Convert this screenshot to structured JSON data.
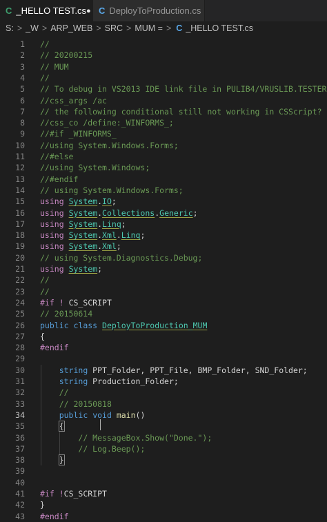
{
  "tabs": [
    {
      "label": "_HELLO TEST.cs",
      "icon": "csharp-icon",
      "active": true,
      "modified_dot": "●"
    },
    {
      "label": "DeployToProduction.cs",
      "icon": "csharp-icon",
      "active": false
    }
  ],
  "breadcrumb": {
    "parts": [
      "S:",
      "_W",
      "ARP_WEB",
      "SRC",
      "MUM ="
    ],
    "file": "_HELLO TEST.cs",
    "separator": ">"
  },
  "editor": {
    "current_line": 34,
    "lines": [
      {
        "n": "1",
        "tokens": [
          {
            "t": "//",
            "c": "comment"
          }
        ]
      },
      {
        "n": "2",
        "tokens": [
          {
            "t": "// 20200215",
            "c": "comment"
          }
        ]
      },
      {
        "n": "3",
        "tokens": [
          {
            "t": "// MUM",
            "c": "comment"
          }
        ]
      },
      {
        "n": "4",
        "tokens": [
          {
            "t": "//",
            "c": "comment"
          }
        ]
      },
      {
        "n": "5",
        "tokens": [
          {
            "t": "// To debug in VS2013 IDE link file in PULIB4/VRUSLIB.TESTER",
            "c": "comment"
          }
        ]
      },
      {
        "n": "6",
        "tokens": [
          {
            "t": "//css_args /ac",
            "c": "comment"
          }
        ]
      },
      {
        "n": "7",
        "tokens": [
          {
            "t": "// the following conditional still not working in CSScript?",
            "c": "comment"
          }
        ]
      },
      {
        "n": "8",
        "tokens": [
          {
            "t": "//css_co /define:_WINFORMS_;",
            "c": "comment"
          }
        ]
      },
      {
        "n": "9",
        "tokens": [
          {
            "t": "//#if _WINFORMS_",
            "c": "comment"
          }
        ]
      },
      {
        "n": "10",
        "tokens": [
          {
            "t": "//using System.Windows.Forms;",
            "c": "comment"
          }
        ]
      },
      {
        "n": "11",
        "tokens": [
          {
            "t": "//#else",
            "c": "comment"
          }
        ]
      },
      {
        "n": "12",
        "tokens": [
          {
            "t": "//using System.Windows;",
            "c": "comment"
          }
        ]
      },
      {
        "n": "13",
        "tokens": [
          {
            "t": "//#endif",
            "c": "comment"
          }
        ]
      },
      {
        "n": "14",
        "tokens": [
          {
            "t": "// using System.Windows.Forms;",
            "c": "comment"
          }
        ]
      },
      {
        "n": "15",
        "tokens": [
          {
            "t": "using",
            "c": "using"
          },
          {
            "t": " ",
            "c": "ident"
          },
          {
            "t": "System",
            "c": "ns"
          },
          {
            "t": ".",
            "c": "ident"
          },
          {
            "t": "IO",
            "c": "ns"
          },
          {
            "t": ";",
            "c": "ident"
          }
        ]
      },
      {
        "n": "16",
        "tokens": [
          {
            "t": "using",
            "c": "using"
          },
          {
            "t": " ",
            "c": "ident"
          },
          {
            "t": "System",
            "c": "ns"
          },
          {
            "t": ".",
            "c": "ident"
          },
          {
            "t": "Collections",
            "c": "ns"
          },
          {
            "t": ".",
            "c": "ident"
          },
          {
            "t": "Generic",
            "c": "ns"
          },
          {
            "t": ";",
            "c": "ident"
          }
        ]
      },
      {
        "n": "17",
        "tokens": [
          {
            "t": "using",
            "c": "using"
          },
          {
            "t": " ",
            "c": "ident"
          },
          {
            "t": "System",
            "c": "ns"
          },
          {
            "t": ".",
            "c": "ident"
          },
          {
            "t": "Linq",
            "c": "ns"
          },
          {
            "t": ";",
            "c": "ident"
          }
        ]
      },
      {
        "n": "18",
        "tokens": [
          {
            "t": "using",
            "c": "using"
          },
          {
            "t": " ",
            "c": "ident"
          },
          {
            "t": "System",
            "c": "ns"
          },
          {
            "t": ".",
            "c": "ident"
          },
          {
            "t": "Xml",
            "c": "ns"
          },
          {
            "t": ".",
            "c": "ident"
          },
          {
            "t": "Linq",
            "c": "ns"
          },
          {
            "t": ";",
            "c": "ident"
          }
        ]
      },
      {
        "n": "19",
        "tokens": [
          {
            "t": "using",
            "c": "using"
          },
          {
            "t": " ",
            "c": "ident"
          },
          {
            "t": "System",
            "c": "ns"
          },
          {
            "t": ".",
            "c": "ident"
          },
          {
            "t": "Xml",
            "c": "ns"
          },
          {
            "t": ";",
            "c": "ident"
          }
        ]
      },
      {
        "n": "20",
        "tokens": [
          {
            "t": "// using System.Diagnostics.Debug;",
            "c": "comment"
          }
        ]
      },
      {
        "n": "21",
        "tokens": [
          {
            "t": "using",
            "c": "using"
          },
          {
            "t": " ",
            "c": "ident"
          },
          {
            "t": "System",
            "c": "ns"
          },
          {
            "t": ";",
            "c": "ident"
          }
        ]
      },
      {
        "n": "22",
        "tokens": [
          {
            "t": "//",
            "c": "comment"
          }
        ]
      },
      {
        "n": "23",
        "tokens": [
          {
            "t": "//",
            "c": "comment"
          }
        ]
      },
      {
        "n": "24",
        "tokens": [
          {
            "t": "#if",
            "c": "pp"
          },
          {
            "t": " ! ",
            "c": "pp"
          },
          {
            "t": "CS_SCRIPT",
            "c": "ppname"
          }
        ]
      },
      {
        "n": "25",
        "tokens": [
          {
            "t": "// 20150614",
            "c": "comment"
          }
        ]
      },
      {
        "n": "26",
        "tokens": [
          {
            "t": "public",
            "c": "kw"
          },
          {
            "t": " ",
            "c": "ident"
          },
          {
            "t": "class",
            "c": "kw"
          },
          {
            "t": " ",
            "c": "ident"
          },
          {
            "t": "DeployToProduction_MUM",
            "c": "type"
          }
        ]
      },
      {
        "n": "27",
        "tokens": [
          {
            "t": "{",
            "c": "brace"
          }
        ]
      },
      {
        "n": "28",
        "tokens": [
          {
            "t": "#endif",
            "c": "pp"
          }
        ]
      },
      {
        "n": "29",
        "tokens": []
      },
      {
        "n": "30",
        "tokens": [
          {
            "t": "    ",
            "c": "ident"
          },
          {
            "t": "string",
            "c": "kw"
          },
          {
            "t": " PPT_Folder, PPT_File, BMP_Folder, SND_Folder;",
            "c": "ident"
          }
        ]
      },
      {
        "n": "31",
        "tokens": [
          {
            "t": "    ",
            "c": "ident"
          },
          {
            "t": "string",
            "c": "kw"
          },
          {
            "t": " Production_Folder;",
            "c": "ident"
          }
        ]
      },
      {
        "n": "32",
        "tokens": [
          {
            "t": "    ",
            "c": "ident"
          },
          {
            "t": "//",
            "c": "comment"
          }
        ]
      },
      {
        "n": "33",
        "tokens": [
          {
            "t": "    ",
            "c": "ident"
          },
          {
            "t": "// 20150818",
            "c": "comment"
          }
        ]
      },
      {
        "n": "34",
        "tokens": [
          {
            "t": "    ",
            "c": "ident"
          },
          {
            "t": "public",
            "c": "kw"
          },
          {
            "t": " ",
            "c": "ident"
          },
          {
            "t": "void",
            "c": "kw"
          },
          {
            "t": " ",
            "c": "ident"
          },
          {
            "t": "main",
            "c": "fn"
          },
          {
            "t": "()",
            "c": "ident"
          }
        ]
      },
      {
        "n": "35",
        "tokens": [
          {
            "t": "    ",
            "c": "ident"
          },
          {
            "t": "{",
            "c": "brace-match"
          }
        ]
      },
      {
        "n": "36",
        "tokens": [
          {
            "t": "        ",
            "c": "ident"
          },
          {
            "t": "// MessageBox.Show(\"Done.\");",
            "c": "comment"
          }
        ]
      },
      {
        "n": "37",
        "tokens": [
          {
            "t": "        ",
            "c": "ident"
          },
          {
            "t": "// Log.Beep();",
            "c": "comment"
          }
        ]
      },
      {
        "n": "38",
        "tokens": [
          {
            "t": "    ",
            "c": "ident"
          },
          {
            "t": "}",
            "c": "brace-match"
          }
        ]
      },
      {
        "n": "39",
        "tokens": []
      },
      {
        "n": "40",
        "tokens": []
      },
      {
        "n": "41",
        "tokens": [
          {
            "t": "#if",
            "c": "pp"
          },
          {
            "t": " !",
            "c": "pp"
          },
          {
            "t": "CS_SCRIPT",
            "c": "ppname"
          }
        ]
      },
      {
        "n": "42",
        "tokens": [
          {
            "t": "}",
            "c": "brace"
          }
        ]
      },
      {
        "n": "43",
        "tokens": [
          {
            "t": "#endif",
            "c": "pp"
          }
        ]
      }
    ]
  }
}
